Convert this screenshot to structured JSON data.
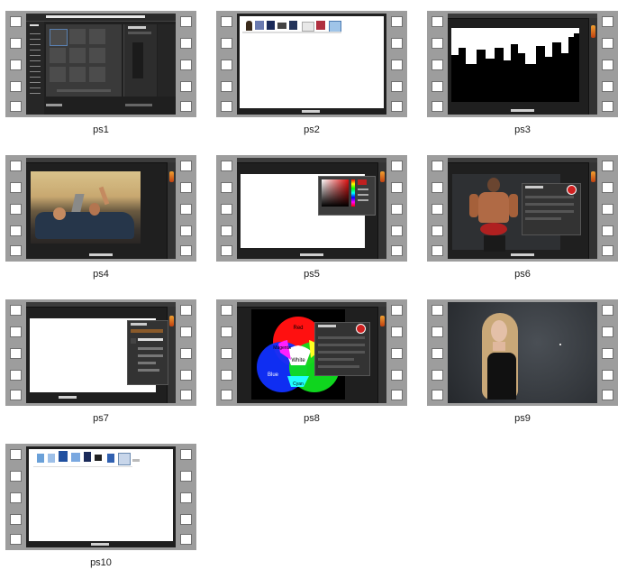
{
  "items": [
    {
      "caption": "ps1"
    },
    {
      "caption": "ps2"
    },
    {
      "caption": "ps3"
    },
    {
      "caption": "ps4"
    },
    {
      "caption": "ps5"
    },
    {
      "caption": "ps6"
    },
    {
      "caption": "ps7"
    },
    {
      "caption": "ps8"
    },
    {
      "caption": "ps9"
    },
    {
      "caption": "ps10"
    }
  ],
  "ps8_venn": {
    "red": "Red",
    "magenta": "Magenta",
    "white": "White",
    "blue": "Blue",
    "cyan": "Cyan"
  },
  "colors": {
    "film_gray": "#9d9d9d",
    "frame_dark": "#1f1f1f",
    "accent_orange": "#e07a20"
  }
}
